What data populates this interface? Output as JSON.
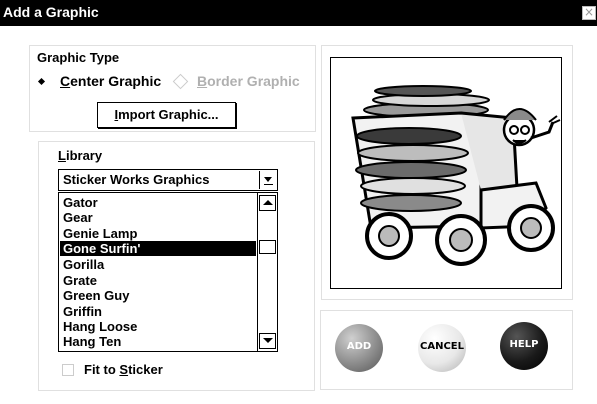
{
  "window": {
    "title": "Add a Graphic",
    "close_glyph": "×"
  },
  "graphic_type": {
    "label": "Graphic Type",
    "center": {
      "mnemonic": "C",
      "rest": "enter Graphic"
    },
    "border": {
      "mnemonic": "B",
      "rest": "order Graphic"
    },
    "import": {
      "mnemonic": "I",
      "rest": "mport Graphic..."
    }
  },
  "library": {
    "label_mnemonic": "L",
    "label_rest": "ibrary",
    "selected": "Sticker Works Graphics",
    "items": [
      "Gator",
      "Gear",
      "Genie Lamp",
      "Gone Surfin'",
      "Gorilla",
      "Grate",
      "Green Guy",
      "Griffin",
      "Hang Loose",
      "Hang Ten"
    ],
    "selected_index": 3,
    "fit": {
      "before": "Fit to ",
      "mnemonic": "S",
      "after": "ticker",
      "checked": false
    }
  },
  "preview": {
    "icon": "surf-truck-illustration"
  },
  "actions": {
    "add": "ADD",
    "cancel": "CANCEL",
    "help": "HELP",
    "colors": {
      "add": "#8c8c8c",
      "cancel": "#e8e8e8",
      "help": "#1a1a1a"
    }
  }
}
